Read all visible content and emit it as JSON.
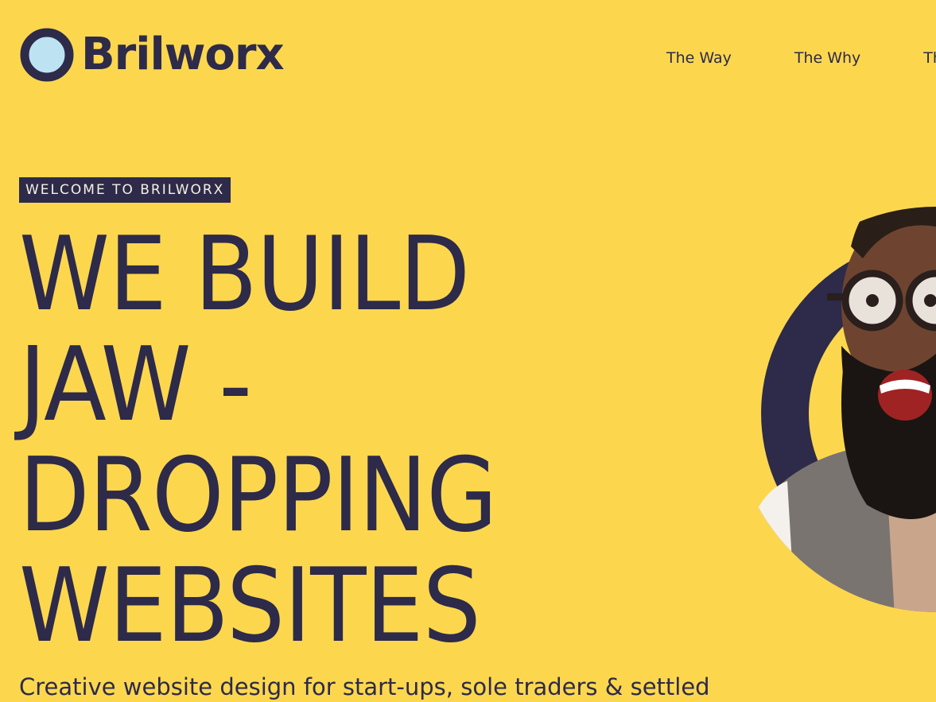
{
  "brand": {
    "name": "Brilworx",
    "logo_icon": "ring-logo-icon",
    "colors": {
      "background": "#FCD74E",
      "primary": "#2D2A4A",
      "logo_inner": "#BDE3F2"
    }
  },
  "nav": {
    "items": [
      {
        "label": "The Way"
      },
      {
        "label": "The Why"
      },
      {
        "label": "Th"
      }
    ]
  },
  "hero": {
    "eyebrow": "WELCOME TO BRILWORX",
    "headline_lines": [
      "WE BUILD",
      "JAW -",
      "DROPPING",
      "WEBSITES"
    ],
    "subtext": "Creative website design for start-ups, sole traders & settled",
    "image": "excited-man-with-glasses-photo"
  }
}
